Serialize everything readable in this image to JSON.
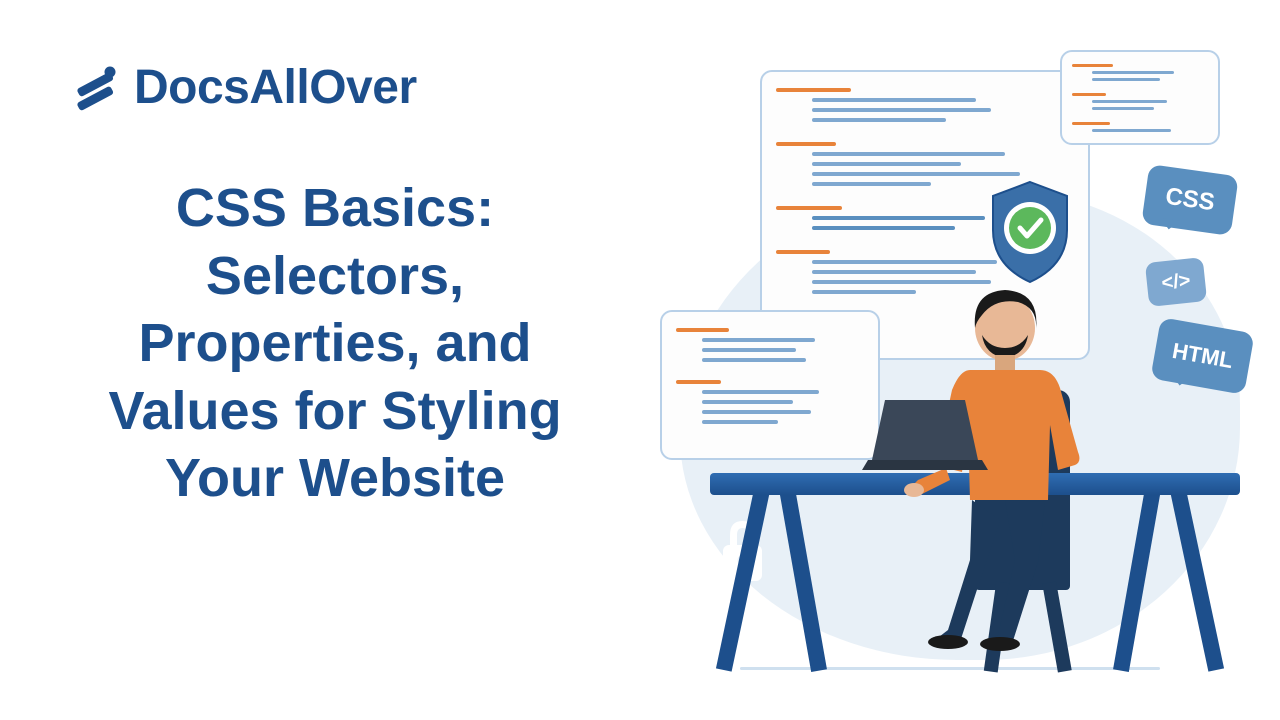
{
  "brand": {
    "name": "DocsAllOver"
  },
  "title": "CSS Basics: Selectors, Properties, and Values for Styling Your Website",
  "bubbles": {
    "css": "CSS",
    "code": "</>",
    "html": "HTML"
  },
  "colors": {
    "primary": "#1d4f8c",
    "accent": "#e8833a",
    "lightBlue": "#7fa8d0"
  }
}
